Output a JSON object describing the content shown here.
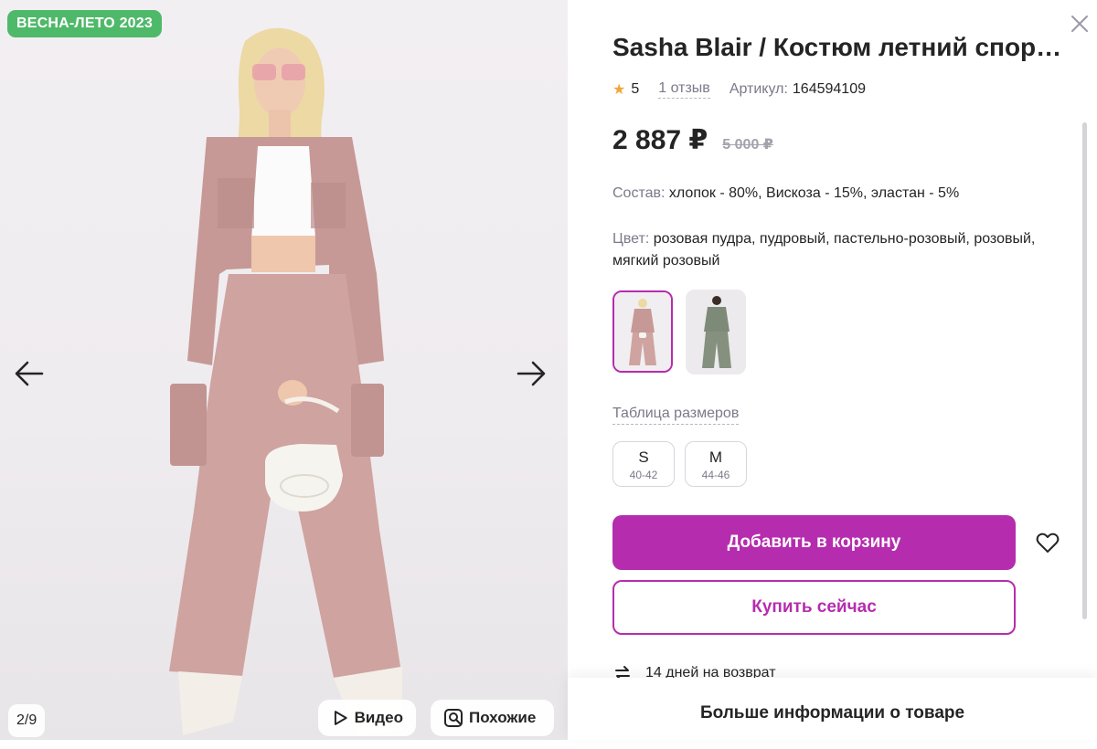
{
  "gallery": {
    "badge": "ВЕСНА-ЛЕТО 2023",
    "counter": "2/9",
    "video_label": "Видео",
    "similar_label": "Похожие"
  },
  "product": {
    "title": "Sasha Blair / Костюм летний спор…",
    "rating": "5",
    "reviews": "1 отзыв",
    "article_label": "Артикул:",
    "article": "164594109",
    "price": "2 887 ₽",
    "old_price": "5 000 ₽",
    "composition_label": "Состав:",
    "composition": "хлопок - 80%, Вискоза - 15%, эластан - 5%",
    "color_label": "Цвет:",
    "color": "розовая пудра, пудровый, пастельно-розовый, розовый, мягкий розовый",
    "size_table": "Таблица размеров",
    "sizes": [
      {
        "name": "S",
        "range": "40-42"
      },
      {
        "name": "M",
        "range": "44-46"
      }
    ],
    "add_to_cart": "Добавить в корзину",
    "buy_now": "Купить сейчас",
    "return": "14 дней на возврат",
    "more_info": "Больше информации о товаре"
  },
  "colors": {
    "accent": "#b52dae",
    "badge_green": "#4fb96a",
    "star": "#f2a63b",
    "muted": "#7a7a8a"
  },
  "icons": [
    "arrow-left-icon",
    "arrow-right-icon",
    "play-icon",
    "search-similar-icon",
    "close-icon",
    "star-icon",
    "heart-icon",
    "return-icon"
  ]
}
